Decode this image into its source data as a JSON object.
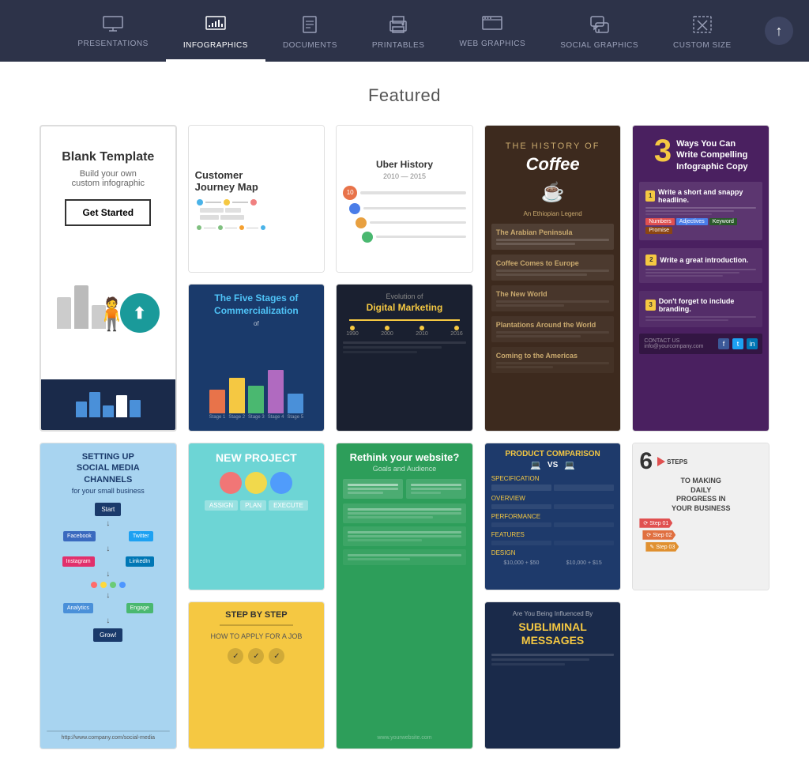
{
  "nav": {
    "items": [
      {
        "id": "presentations",
        "label": "PRESENTATIONS",
        "icon": "🖥",
        "active": false
      },
      {
        "id": "infographics",
        "label": "INFOGRAPHICS",
        "icon": "📊",
        "active": true
      },
      {
        "id": "documents",
        "label": "DOCUMENTS",
        "icon": "📄",
        "active": false
      },
      {
        "id": "printables",
        "label": "PRINTABLES",
        "icon": "🖨",
        "active": false
      },
      {
        "id": "web-graphics",
        "label": "WEB GRAPHICS",
        "icon": "🖥",
        "active": false
      },
      {
        "id": "social-graphics",
        "label": "SOCIAL GRAPHICS",
        "icon": "💬",
        "active": false
      },
      {
        "id": "custom-size",
        "label": "CUSTOM SIZE",
        "icon": "✂",
        "active": false
      }
    ],
    "up_button_label": "↑"
  },
  "main": {
    "featured_title": "Featured",
    "blank_template": {
      "title": "Blank Template",
      "subtitle": "Build your own\ncustom infographic",
      "button_label": "Get Started"
    },
    "cards": [
      {
        "id": "customer-journey-map",
        "title": "Customer Journey Map"
      },
      {
        "id": "uber-history",
        "title": "Uber History"
      },
      {
        "id": "history-of-coffee",
        "title": "THE HISTORY OF Coffee"
      },
      {
        "id": "3-ways-infographic",
        "title": "3 Ways You Can Write Compelling Infographic Copy"
      },
      {
        "id": "five-stages",
        "title": "The Five Stages of Commercialization"
      },
      {
        "id": "digital-marketing",
        "title": "Evolution of Digital Marketing"
      },
      {
        "id": "social-channels",
        "title": "SETTING UP SOCIAL MEDIA CHANNELS for your small business"
      },
      {
        "id": "new-project",
        "title": "NEW PROJECT"
      },
      {
        "id": "rethink-website",
        "title": "Rethink your website?"
      },
      {
        "id": "product-comparison",
        "title": "PRODUCT COMPARISON"
      },
      {
        "id": "6-steps",
        "title": "6 STEPS TO MAKING DAILY PROGRESS IN YOUR BUSINESS"
      },
      {
        "id": "step-by-step",
        "title": "STEP BY STEP"
      },
      {
        "id": "subliminal-messages",
        "title": "Are You Being Influenced By SUBLIMINAL MESSAGES"
      }
    ]
  }
}
